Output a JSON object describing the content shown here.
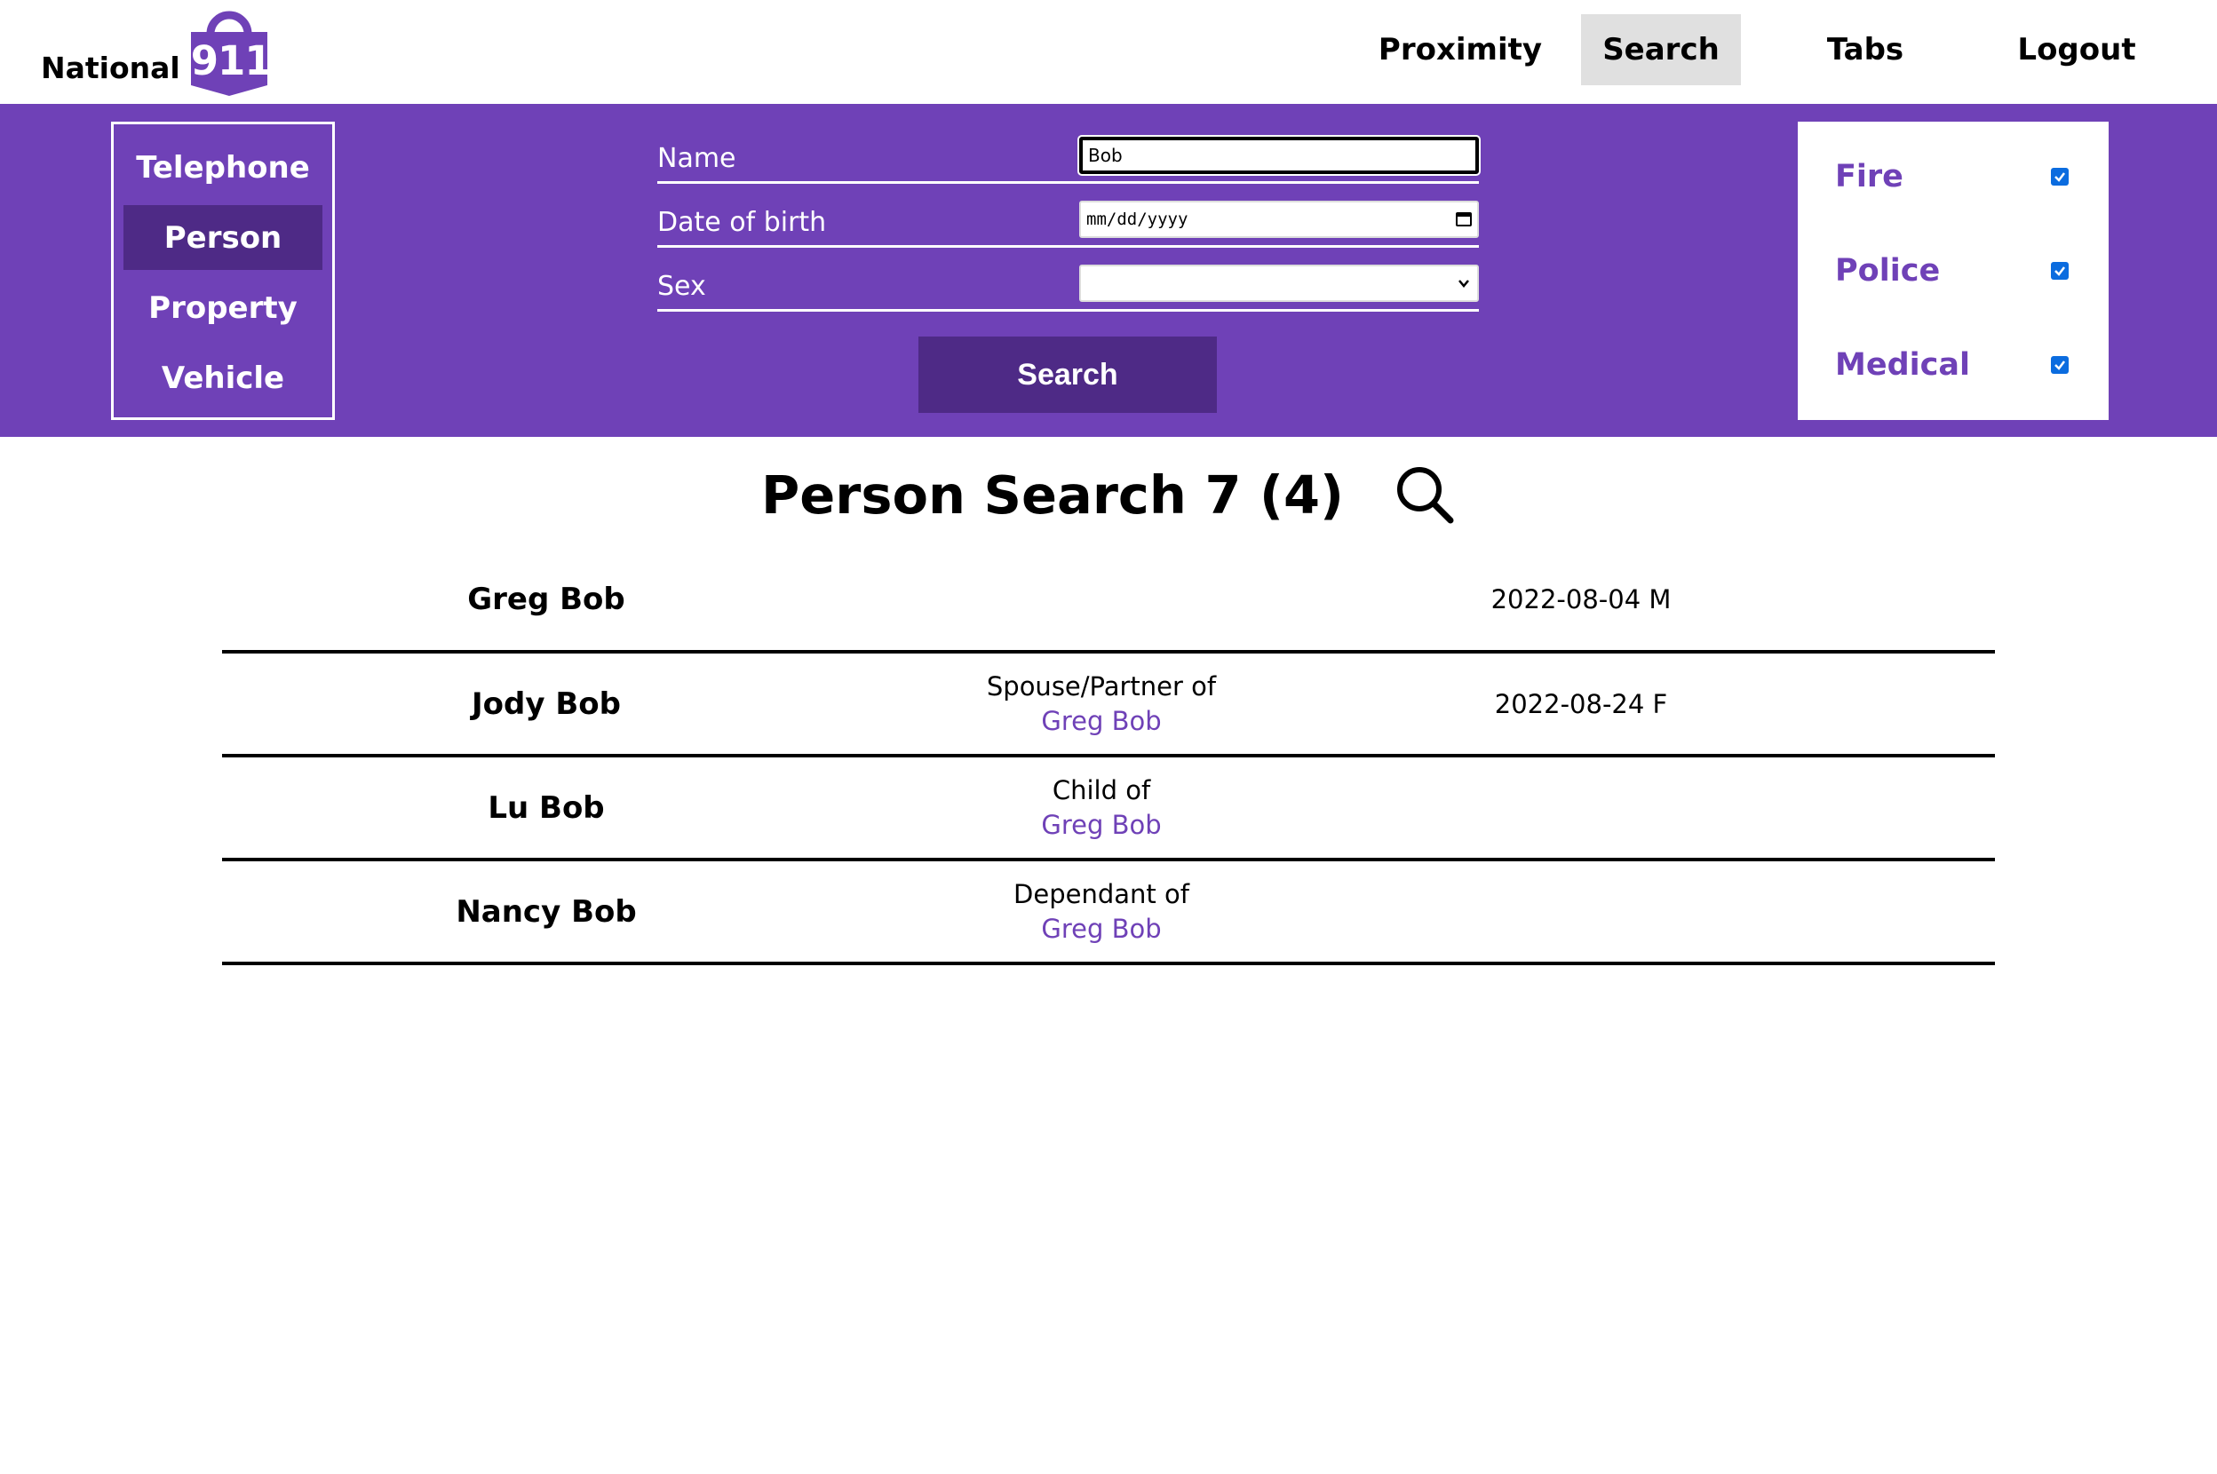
{
  "header": {
    "logo_text": "National",
    "logo_number": "911",
    "nav": {
      "proximity": "Proximity",
      "search": "Search",
      "tabs": "Tabs",
      "logout": "Logout"
    }
  },
  "search_types": [
    {
      "label": "Telephone"
    },
    {
      "label": "Person",
      "active": true
    },
    {
      "label": "Property"
    },
    {
      "label": "Vehicle"
    }
  ],
  "form": {
    "name_label": "Name",
    "name_value": "Bob",
    "dob_label": "Date of birth",
    "dob_placeholder": "mm/dd/yyyy",
    "sex_label": "Sex",
    "sex_value": "",
    "search_button": "Search"
  },
  "filters": {
    "fire": {
      "label": "Fire",
      "checked": true
    },
    "police": {
      "label": "Police",
      "checked": true
    },
    "medical": {
      "label": "Medical",
      "checked": true
    }
  },
  "results": {
    "title": "Person Search 7 (4)",
    "rows": [
      {
        "name": "Greg Bob",
        "relation": "",
        "relation_target": "",
        "meta": "2022-08-04 M"
      },
      {
        "name": "Jody Bob",
        "relation": "Spouse/Partner of",
        "relation_target": "Greg Bob",
        "meta": "2022-08-24 F"
      },
      {
        "name": "Lu Bob",
        "relation": "Child of",
        "relation_target": "Greg Bob",
        "meta": ""
      },
      {
        "name": "Nancy Bob",
        "relation": "Dependant of",
        "relation_target": "Greg Bob",
        "meta": ""
      }
    ]
  },
  "colors": {
    "brand_purple": "#6f41b7",
    "dark_purple": "#4e2a86",
    "nav_active_bg": "#e0e0e0",
    "checkbox_blue": "#0b6cdf"
  }
}
